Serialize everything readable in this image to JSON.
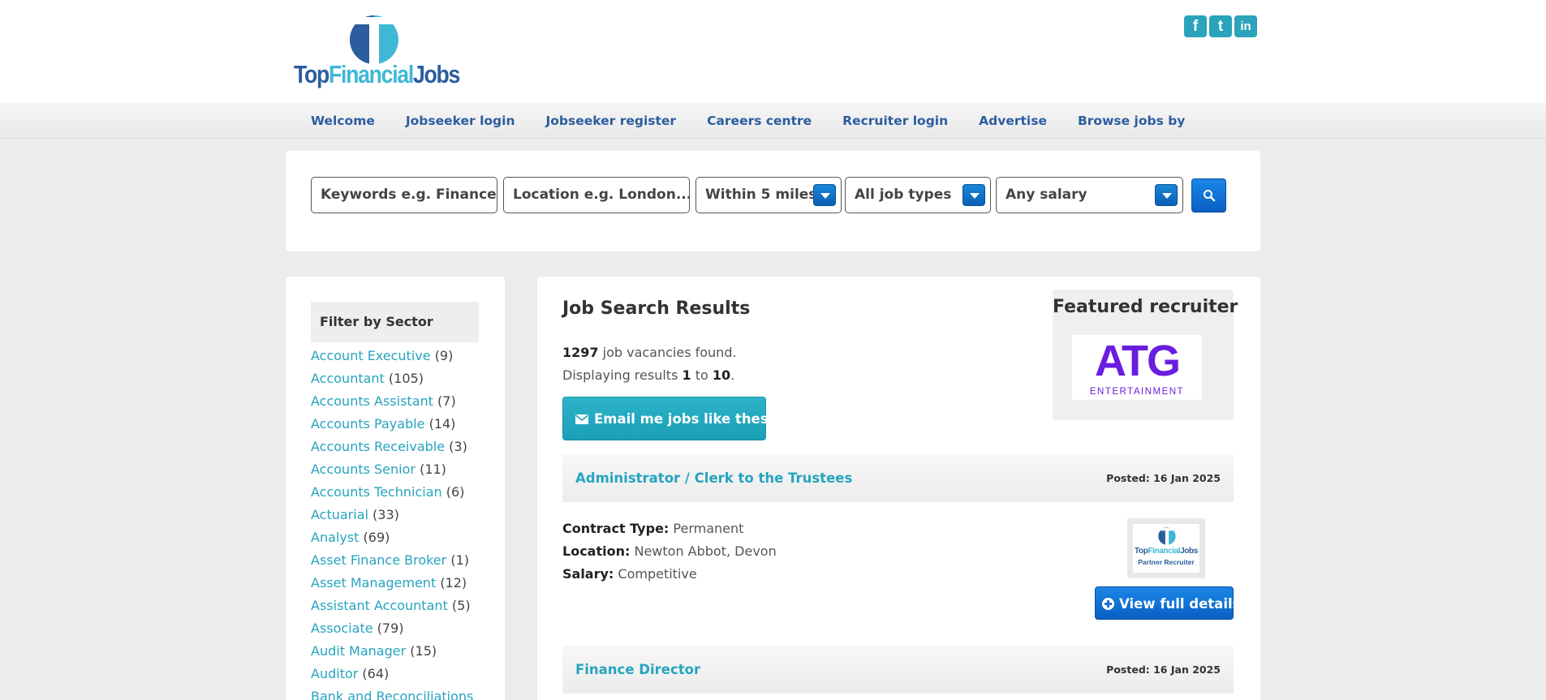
{
  "header": {
    "logo_mark": "T",
    "logo_top": "Top",
    "logo_financial": "Financial",
    "logo_jobs": "Jobs",
    "social": [
      {
        "name": "facebook-icon",
        "glyph": "f"
      },
      {
        "name": "twitter-icon",
        "glyph": "t"
      },
      {
        "name": "linkedin-icon",
        "glyph": "in"
      }
    ]
  },
  "nav": {
    "items": [
      "Welcome",
      "Jobseeker login",
      "Jobseeker register",
      "Careers centre",
      "Recruiter login",
      "Advertise",
      "Browse jobs by"
    ]
  },
  "search": {
    "keywords_placeholder": "Keywords e.g. Finance Ma",
    "location_placeholder": "Location e.g. London...",
    "distance": "Within 5 miles",
    "job_type": "All job types",
    "salary": "Any salary"
  },
  "sidebar": {
    "heading": "Filter by Sector",
    "sectors": [
      {
        "name": "Account Executive",
        "count": "(9)"
      },
      {
        "name": "Accountant",
        "count": "(105)"
      },
      {
        "name": "Accounts Assistant",
        "count": "(7)"
      },
      {
        "name": "Accounts Payable",
        "count": "(14)"
      },
      {
        "name": "Accounts Receivable",
        "count": "(3)"
      },
      {
        "name": "Accounts Senior",
        "count": "(11)"
      },
      {
        "name": "Accounts Technician",
        "count": "(6)"
      },
      {
        "name": "Actuarial",
        "count": "(33)"
      },
      {
        "name": "Analyst",
        "count": "(69)"
      },
      {
        "name": "Asset Finance Broker",
        "count": "(1)"
      },
      {
        "name": "Asset Management",
        "count": "(12)"
      },
      {
        "name": "Assistant Accountant",
        "count": "(5)"
      },
      {
        "name": "Associate",
        "count": "(79)"
      },
      {
        "name": "Audit Manager",
        "count": "(15)"
      },
      {
        "name": "Auditor",
        "count": "(64)"
      },
      {
        "name": "Bank and Reconciliations",
        "count": ""
      }
    ]
  },
  "results": {
    "title": "Job Search Results",
    "count": "1297",
    "count_suffix": " job vacancies found.",
    "display_prefix": "Displaying results ",
    "from": "1",
    "to_word": " to ",
    "to": "10",
    "period": ".",
    "email_button": "Email me jobs like these"
  },
  "featured": {
    "title": "Featured recruiter",
    "logo_main": "ATG",
    "logo_sub": "ENTERTAINMENT"
  },
  "jobs": [
    {
      "title": "Administrator / Clerk to the Trustees",
      "posted": "Posted: 16 Jan 2025",
      "contract_label": "Contract Type:",
      "contract": " Permanent",
      "location_label": "Location:",
      "location": " Newton Abbot, Devon",
      "salary_label": "Salary:",
      "salary": " Competitive",
      "partner_sub": "Partner Recruiter",
      "view_button": "View full details"
    },
    {
      "title": "Finance Director",
      "posted": "Posted: 16 Jan 2025"
    }
  ],
  "colors": {
    "brand_blue": "#2c5d9f",
    "brand_teal": "#26a4bf",
    "button_blue": "#0a5fc4",
    "featured_purple": "#6a1de0"
  }
}
